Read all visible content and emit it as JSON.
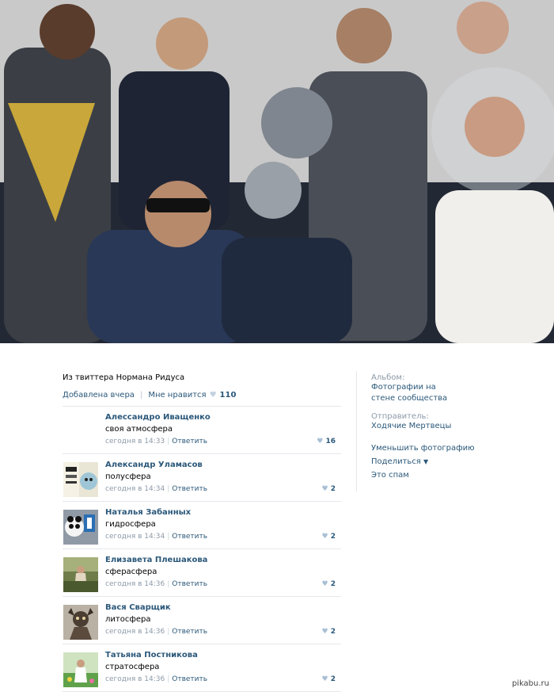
{
  "caption": "Из твиттера Нормана Ридуса",
  "likes": {
    "added_label": "Добавлена вчера",
    "like_label": "Мне нравится",
    "count": "110"
  },
  "comments": [
    {
      "name": "Алессандро Иващенко",
      "text": "своя атмосфера",
      "time": "сегодня в 14:33",
      "reply": "Ответить",
      "likes": "16",
      "avatar": "none"
    },
    {
      "name": "Александр Уламасов",
      "text": "полусфера",
      "time": "сегодня в 14:34",
      "reply": "Ответить",
      "likes": "2",
      "avatar": "meme-icon"
    },
    {
      "name": "Наталья Забанных",
      "text": "гидросфера",
      "time": "сегодня в 14:34",
      "reply": "Ответить",
      "likes": "2",
      "avatar": "panda-icon"
    },
    {
      "name": "Елизавета Плешакова",
      "text": "сферасфера",
      "time": "сегодня в 14:36",
      "reply": "Ответить",
      "likes": "2",
      "avatar": "forest-icon"
    },
    {
      "name": "Вася Сварщик",
      "text": "литосфера",
      "time": "сегодня в 14:36",
      "reply": "Ответить",
      "likes": "2",
      "avatar": "monster-icon"
    },
    {
      "name": "Татьяна Постникова",
      "text": "стратосфера",
      "time": "сегодня в 14:36",
      "reply": "Ответить",
      "likes": "2",
      "avatar": "flowers-icon"
    }
  ],
  "sidebar": {
    "album_label": "Альбом:",
    "album_value": "Фотографии на стене сообщества",
    "sender_label": "Отправитель:",
    "sender_value": "Ходячие Мертвецы",
    "shrink": "Уменьшить фотографию",
    "share": "Поделиться",
    "spam": "Это спам"
  },
  "watermark": "pikabu.ru",
  "colors": {
    "link": "#2b587a",
    "muted": "#8c9aa8",
    "divider": "#e4e8ec"
  }
}
